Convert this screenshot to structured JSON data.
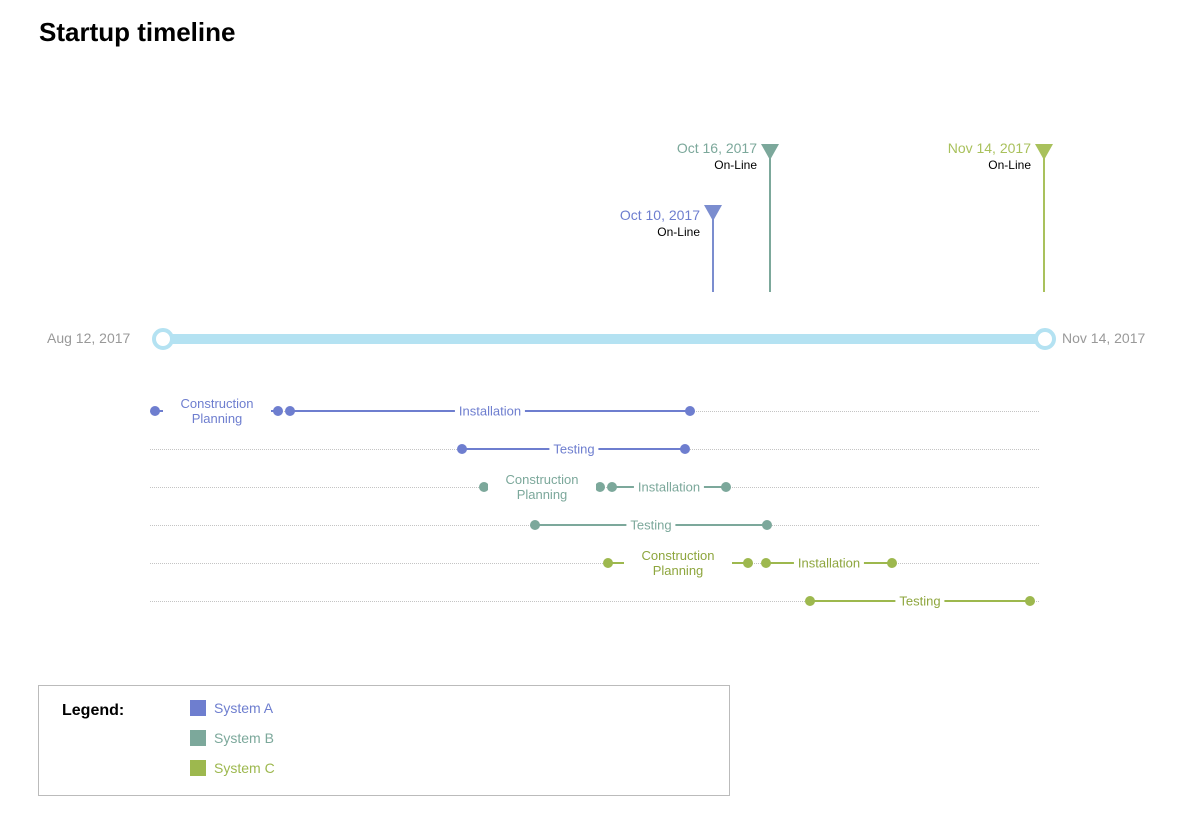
{
  "title": "Startup timeline",
  "timeline": {
    "start_label": "Aug 12, 2017",
    "end_label": "Nov 14, 2017"
  },
  "milestones": {
    "a": {
      "date": "Oct 10, 2017",
      "label": "On-Line"
    },
    "b": {
      "date": "Oct 16, 2017",
      "label": "On-Line"
    },
    "c": {
      "date": "Nov 14, 2017",
      "label": "On-Line"
    }
  },
  "tasks": {
    "a1": "Construction Planning",
    "a2": "Installation",
    "a3": "Testing",
    "b1": "Construction Planning",
    "b2": "Installation",
    "b3": "Testing",
    "c1": "Construction Planning",
    "c2": "Installation",
    "c3": "Testing"
  },
  "legend": {
    "title": "Legend:",
    "a": "System A",
    "b": "System B",
    "c": "System C"
  },
  "chart_data": {
    "type": "gantt",
    "title": "Startup timeline",
    "x_axis": {
      "type": "date",
      "start": "2017-08-12",
      "end": "2017-11-14"
    },
    "series": [
      {
        "name": "System A",
        "color": "#6e7ecf",
        "tasks": [
          {
            "name": "Construction Planning",
            "start": "2017-08-12",
            "end": "2017-08-25"
          },
          {
            "name": "Installation",
            "start": "2017-08-26",
            "end": "2017-10-09"
          },
          {
            "name": "Testing",
            "start": "2017-09-14",
            "end": "2017-10-09"
          }
        ],
        "milestone": {
          "name": "On-Line",
          "date": "2017-10-10"
        }
      },
      {
        "name": "System B",
        "color": "#7ca89b",
        "tasks": [
          {
            "name": "Construction Planning",
            "start": "2017-09-16",
            "end": "2017-09-30"
          },
          {
            "name": "Installation",
            "start": "2017-10-01",
            "end": "2017-10-13"
          },
          {
            "name": "Testing",
            "start": "2017-09-21",
            "end": "2017-10-16"
          }
        ],
        "milestone": {
          "name": "On-Line",
          "date": "2017-10-16"
        }
      },
      {
        "name": "System C",
        "color": "#9db84e",
        "tasks": [
          {
            "name": "Construction Planning",
            "start": "2017-10-01",
            "end": "2017-10-16"
          },
          {
            "name": "Installation",
            "start": "2017-10-19",
            "end": "2017-11-01"
          },
          {
            "name": "Testing",
            "start": "2017-10-24",
            "end": "2017-11-14"
          }
        ],
        "milestone": {
          "name": "On-Line",
          "date": "2017-11-14"
        }
      }
    ],
    "legend": [
      "System A",
      "System B",
      "System C"
    ]
  }
}
